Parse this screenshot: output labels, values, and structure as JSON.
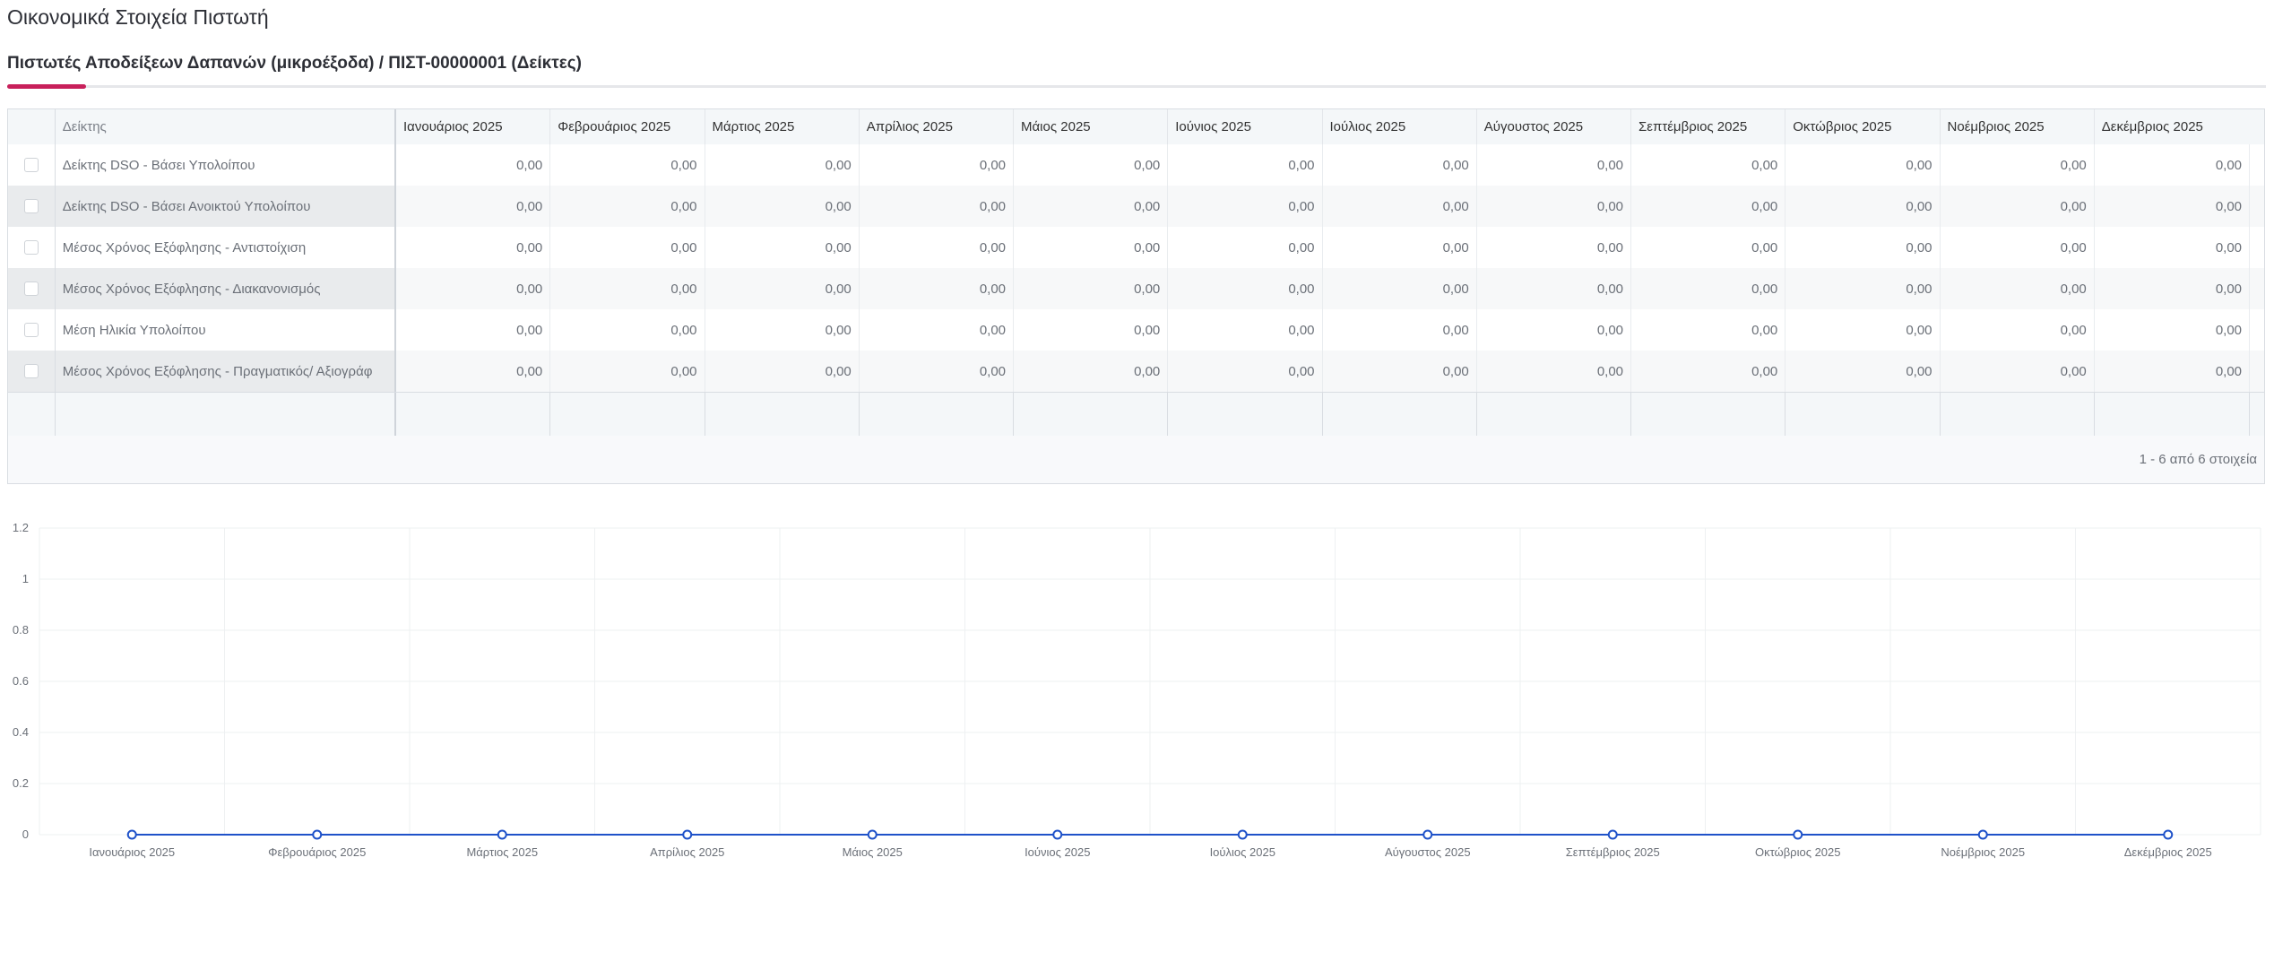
{
  "page": {
    "title": "Οικονομικά Στοιχεία Πιστωτή",
    "subtitle": "Πιστωτές Αποδείξεων Δαπανών (μικροέξοδα) / ΠΙΣΤ-00000001 (Δείκτες)"
  },
  "grid": {
    "name_header": "Δείκτης",
    "months": [
      "Ιανουάριος 2025",
      "Φεβρουάριος 2025",
      "Μάρτιος 2025",
      "Απρίλιος 2025",
      "Μάιος 2025",
      "Ιούνιος 2025",
      "Ιούλιος 2025",
      "Αύγουστος 2025",
      "Σεπτέμβριος 2025",
      "Οκτώβριος 2025",
      "Νοέμβριος 2025",
      "Δεκέμβριος 2025"
    ],
    "rows": [
      {
        "name": "Δείκτης DSO - Βάσει Υπολοίπου",
        "values": [
          "0,00",
          "0,00",
          "0,00",
          "0,00",
          "0,00",
          "0,00",
          "0,00",
          "0,00",
          "0,00",
          "0,00",
          "0,00",
          "0,00"
        ]
      },
      {
        "name": "Δείκτης DSO - Βάσει Ανοικτού Υπολοίπου",
        "values": [
          "0,00",
          "0,00",
          "0,00",
          "0,00",
          "0,00",
          "0,00",
          "0,00",
          "0,00",
          "0,00",
          "0,00",
          "0,00",
          "0,00"
        ]
      },
      {
        "name": "Μέσος Χρόνος Εξόφλησης - Αντιστοίχιση",
        "values": [
          "0,00",
          "0,00",
          "0,00",
          "0,00",
          "0,00",
          "0,00",
          "0,00",
          "0,00",
          "0,00",
          "0,00",
          "0,00",
          "0,00"
        ]
      },
      {
        "name": "Μέσος Χρόνος Εξόφλησης - Διακανονισμός",
        "values": [
          "0,00",
          "0,00",
          "0,00",
          "0,00",
          "0,00",
          "0,00",
          "0,00",
          "0,00",
          "0,00",
          "0,00",
          "0,00",
          "0,00"
        ]
      },
      {
        "name": "Μέση Ηλικία Υπολοίπου",
        "values": [
          "0,00",
          "0,00",
          "0,00",
          "0,00",
          "0,00",
          "0,00",
          "0,00",
          "0,00",
          "0,00",
          "0,00",
          "0,00",
          "0,00"
        ]
      },
      {
        "name": "Μέσος Χρόνος Εξόφλησης - Πραγματικός/ Αξιογράφ",
        "values": [
          "0,00",
          "0,00",
          "0,00",
          "0,00",
          "0,00",
          "0,00",
          "0,00",
          "0,00",
          "0,00",
          "0,00",
          "0,00",
          "0,00"
        ]
      }
    ],
    "pager_text": "1 - 6 από 6 στοιχεία"
  },
  "colors": {
    "accent": "#c8205b",
    "line": "#1f52c9",
    "grid_line": "#eef0f2"
  },
  "chart_data": {
    "type": "line",
    "categories": [
      "Ιανουάριος 2025",
      "Φεβρουάριος 2025",
      "Μάρτιος 2025",
      "Απρίλιος 2025",
      "Μάιος 2025",
      "Ιούνιος 2025",
      "Ιούλιος 2025",
      "Αύγουστος 2025",
      "Σεπτέμβριος 2025",
      "Οκτώβριος 2025",
      "Νοέμβριος 2025",
      "Δεκέμβριος 2025"
    ],
    "series": [
      {
        "values": [
          0,
          0,
          0,
          0,
          0,
          0,
          0,
          0,
          0,
          0,
          0,
          0
        ]
      }
    ],
    "y_ticks": [
      "0",
      "0.2",
      "0.4",
      "0.6",
      "0.8",
      "1",
      "1.2"
    ],
    "ylim": [
      0,
      1.2
    ],
    "grid": true,
    "title": "",
    "xlabel": "",
    "ylabel": ""
  }
}
